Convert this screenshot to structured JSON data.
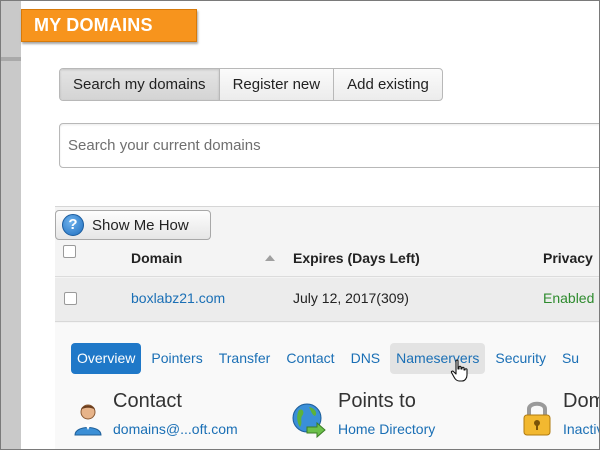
{
  "banner": {
    "title": "MY DOMAINS"
  },
  "segmented": {
    "search_label": "Search my domains",
    "register_label": "Register new",
    "add_label": "Add existing"
  },
  "search": {
    "placeholder": "Search your current domains"
  },
  "help": {
    "label": "Show Me How",
    "icon": "question-icon"
  },
  "table": {
    "columns": [
      "Domain",
      "Expires (Days Left)",
      "Privacy"
    ],
    "rows": [
      {
        "domain": "boxlabz21.com",
        "expires": "July 12, 2017(309)",
        "privacy": "Enabled"
      }
    ]
  },
  "detail_tabs": [
    {
      "label": "Overview"
    },
    {
      "label": "Pointers"
    },
    {
      "label": "Transfer"
    },
    {
      "label": "Contact"
    },
    {
      "label": "DNS"
    },
    {
      "label": "Nameservers"
    },
    {
      "label": "Security"
    },
    {
      "label": "Su"
    }
  ],
  "cards": {
    "contact": {
      "title": "Contact",
      "value": "domains@...oft.com",
      "icon": "person-icon"
    },
    "points_to": {
      "title": "Points to",
      "value": "Home Directory",
      "icon": "globe-arrow-icon"
    },
    "domain_lock": {
      "title": "Dom",
      "value": "Inactiv",
      "icon": "padlock-icon"
    }
  },
  "colors": {
    "banner": "#f7941d",
    "link": "#1a6fb5",
    "active_tab": "#1f78c8",
    "enabled": "#2e8b2e"
  }
}
